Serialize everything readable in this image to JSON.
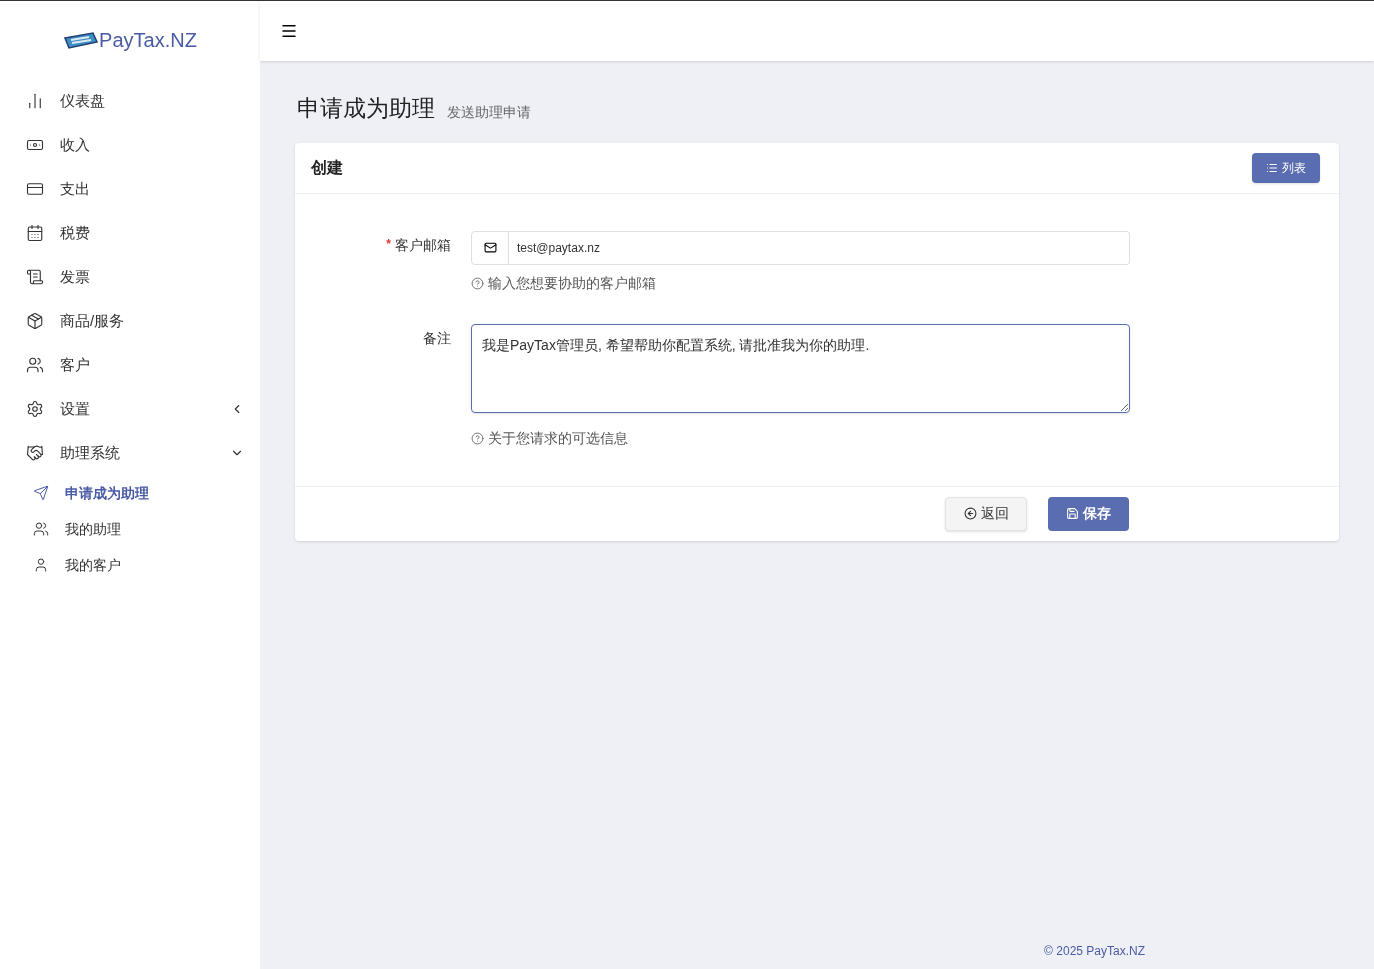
{
  "brand": {
    "name": "PayTax.NZ"
  },
  "sidebar": {
    "items": [
      {
        "label": "仪表盘",
        "kind": "link"
      },
      {
        "label": "收入",
        "kind": "link"
      },
      {
        "label": "支出",
        "kind": "link"
      },
      {
        "label": "税费",
        "kind": "link"
      },
      {
        "label": "发票",
        "kind": "link"
      },
      {
        "label": "商品/服务",
        "kind": "link"
      },
      {
        "label": "客户",
        "kind": "link"
      },
      {
        "label": "设置",
        "kind": "group",
        "expanded": false
      },
      {
        "label": "助理系统",
        "kind": "group",
        "expanded": true,
        "children": [
          {
            "label": "申请成为助理",
            "selected": true
          },
          {
            "label": "我的助理",
            "selected": false
          },
          {
            "label": "我的客户",
            "selected": false
          }
        ]
      }
    ]
  },
  "page": {
    "title": "申请成为助理",
    "subtitle": "发送助理申请"
  },
  "card": {
    "title": "创建",
    "list_button": "列表",
    "fields": [
      {
        "kind": "email",
        "label": "客户邮箱",
        "required_mark": "*",
        "value": "test@paytax.nz",
        "help": "输入您想要协助的客户邮箱"
      },
      {
        "kind": "textarea",
        "label": "备注",
        "value": "我是PayTax管理员, 希望帮助你配置系统, 请批准我为你的助理.",
        "help": "关于您请求的可选信息"
      }
    ],
    "buttons": [
      {
        "kind": "back",
        "label": "返回"
      },
      {
        "kind": "save",
        "label": "保存"
      }
    ]
  },
  "footer": {
    "text": "© 2025 PayTax.NZ"
  }
}
